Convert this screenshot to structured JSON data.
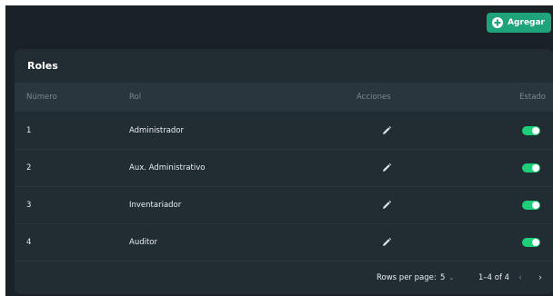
{
  "header": {
    "add_label": "Agregar"
  },
  "card": {
    "title": "Roles"
  },
  "table": {
    "columns": [
      "Número",
      "Rol",
      "Acciones",
      "Estado"
    ],
    "rows": [
      {
        "numero": "1",
        "rol": "Administrador",
        "estado": true
      },
      {
        "numero": "2",
        "rol": "Aux. Administrativo",
        "estado": true
      },
      {
        "numero": "3",
        "rol": "Inventariador",
        "estado": true
      },
      {
        "numero": "4",
        "rol": "Auditor",
        "estado": true
      }
    ]
  },
  "pagination": {
    "rows_per_page_label": "Rows per page:",
    "rows_per_page_value": "5",
    "range_label": "1–4 of 4"
  },
  "icons": {
    "add": "plus-circle-icon",
    "edit": "pencil-icon",
    "dropdown": "chevron-down-icon",
    "prev": "chevron-left-icon",
    "next": "chevron-right-icon"
  },
  "colors": {
    "accent": "#1ea37a",
    "toggle_on": "#1fce79",
    "background": "#1a2127",
    "card": "#222c33",
    "header_row": "#2a363e"
  }
}
